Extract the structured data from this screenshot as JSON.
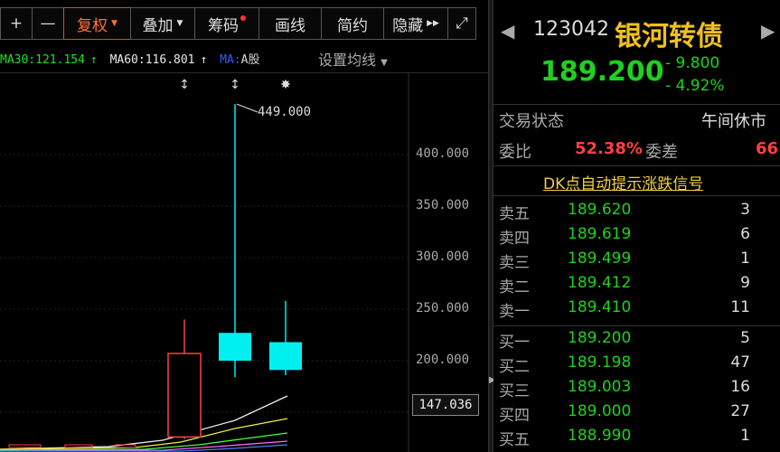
{
  "toolbar": {
    "plus": "+",
    "minus": "—",
    "fuquan": "复权",
    "diejia": "叠加",
    "chouma": "筹码",
    "huaxian": "画线",
    "jianyue": "简约",
    "yincang": "隐藏",
    "expand_icon": "⤢"
  },
  "ma": {
    "ma30": "MA30:121.154",
    "ma60": "MA60:116.801",
    "ma_label": "MA:",
    "a_share": "A股",
    "settings": "设置均线"
  },
  "chart_data": {
    "type": "candlestick",
    "y_ticks": [
      "400.000",
      "350.000",
      "300.000",
      "250.000",
      "200.000"
    ],
    "high_annotation": "449.000",
    "last_price": "147.036",
    "candles": [
      {
        "open": 126,
        "close": 207,
        "high": 240,
        "low": 124,
        "color": "red"
      },
      {
        "open": 227,
        "close": 200,
        "high": 449,
        "low": 184,
        "color": "cyan"
      },
      {
        "open": 218,
        "close": 191,
        "high": 258,
        "low": 186,
        "color": "cyan"
      }
    ],
    "y_range": [
      123,
      449
    ]
  },
  "quote": {
    "code": "123042",
    "name": "银河转债",
    "price": "189.200",
    "change": "- 9.800",
    "change_pct": "- 4.92%",
    "trade_status_label": "交易状态",
    "trade_status": "午间休市",
    "weibi_label": "委比",
    "weibi": "52.38%",
    "weicha_label": "委差",
    "weicha": "66",
    "dk_link": "DK点自动提示涨跌信号"
  },
  "orderbook": {
    "asks": [
      {
        "label": "卖五",
        "price": "189.620",
        "vol": "3"
      },
      {
        "label": "卖四",
        "price": "189.619",
        "vol": "6"
      },
      {
        "label": "卖三",
        "price": "189.499",
        "vol": "1"
      },
      {
        "label": "卖二",
        "price": "189.412",
        "vol": "9"
      },
      {
        "label": "卖一",
        "price": "189.410",
        "vol": "11"
      }
    ],
    "bids": [
      {
        "label": "买一",
        "price": "189.200",
        "vol": "5"
      },
      {
        "label": "买二",
        "price": "189.198",
        "vol": "47"
      },
      {
        "label": "买三",
        "price": "189.003",
        "vol": "16"
      },
      {
        "label": "买四",
        "price": "189.000",
        "vol": "27"
      },
      {
        "label": "买五",
        "price": "188.990",
        "vol": "1"
      }
    ]
  }
}
